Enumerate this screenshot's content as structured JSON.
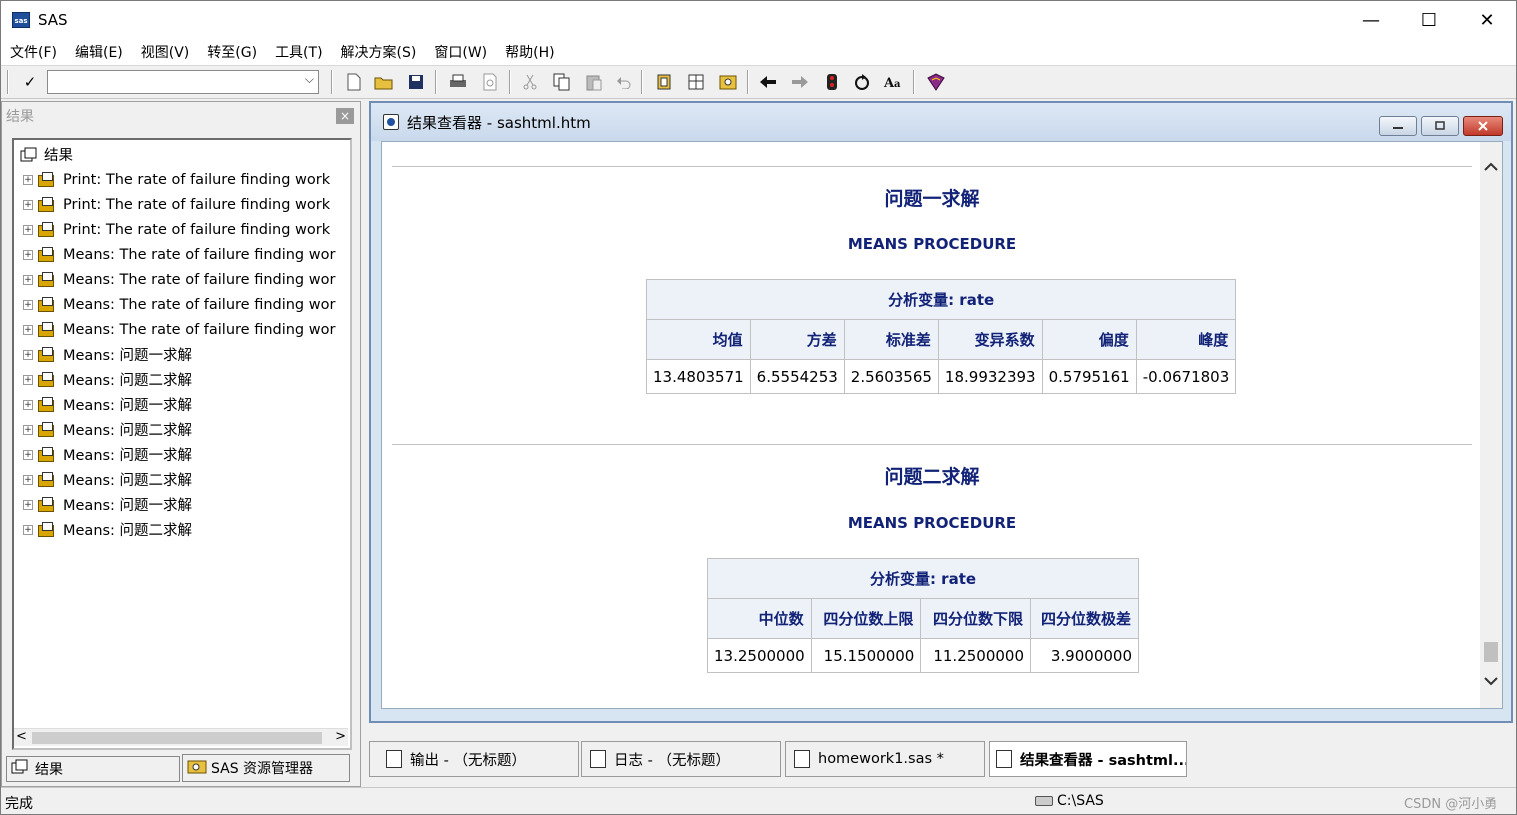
{
  "window": {
    "title": "SAS",
    "controls": [
      "—",
      "☐",
      "✕"
    ]
  },
  "menu": [
    "文件(F)",
    "编辑(E)",
    "视图(V)",
    "转至(G)",
    "工具(T)",
    "解决方案(S)",
    "窗口(W)",
    "帮助(H)"
  ],
  "toolbar": {
    "command_value": "",
    "check_glyph": "✓",
    "dropdown_glyph": "⌵"
  },
  "results_panel": {
    "title": "结果",
    "close_glyph": "×",
    "root": "结果",
    "items": [
      "Print:  The rate of failure finding work",
      "Print:  The rate of failure finding work",
      "Print:  The rate of failure finding work",
      "Means:  The rate of failure finding wor",
      "Means:  The rate of failure finding wor",
      "Means:  The rate of failure finding wor",
      "Means:  The rate of failure finding wor",
      "Means:  问题一求解",
      "Means:  问题二求解",
      "Means:  问题一求解",
      "Means:  问题二求解",
      "Means:  问题一求解",
      "Means:  问题二求解",
      "Means:  问题一求解",
      "Means:  问题二求解"
    ],
    "tabs": [
      "结果",
      "SAS 资源管理器"
    ],
    "scroll_left": "<",
    "scroll_right": ">"
  },
  "viewer": {
    "title": "结果查看器 - sashtml.htm",
    "sections": [
      {
        "title": "问题一求解",
        "procedure": "MEANS PROCEDURE",
        "table_header": "分析变量: rate",
        "columns": [
          "均值",
          "方差",
          "标准差",
          "变异系数",
          "偏度",
          "峰度"
        ],
        "values": [
          "13.4803571",
          "6.5554253",
          "2.5603565",
          "18.9932393",
          "0.5795161",
          "-0.0671803"
        ]
      },
      {
        "title": "问题二求解",
        "procedure": "MEANS PROCEDURE",
        "table_header": "分析变量: rate",
        "columns": [
          "中位数",
          "四分位数上限",
          "四分位数下限",
          "四分位数极差"
        ],
        "values": [
          "13.2500000",
          "15.1500000",
          "11.2500000",
          "3.9000000"
        ]
      }
    ]
  },
  "doc_tabs": [
    "输出 - （无标题）",
    "日志 - （无标题）",
    "homework1.sas *",
    "结果查看器 - sashtml...."
  ],
  "status": {
    "message": "完成",
    "path": "C:\\SAS",
    "watermark": "CSDN @河小勇"
  }
}
